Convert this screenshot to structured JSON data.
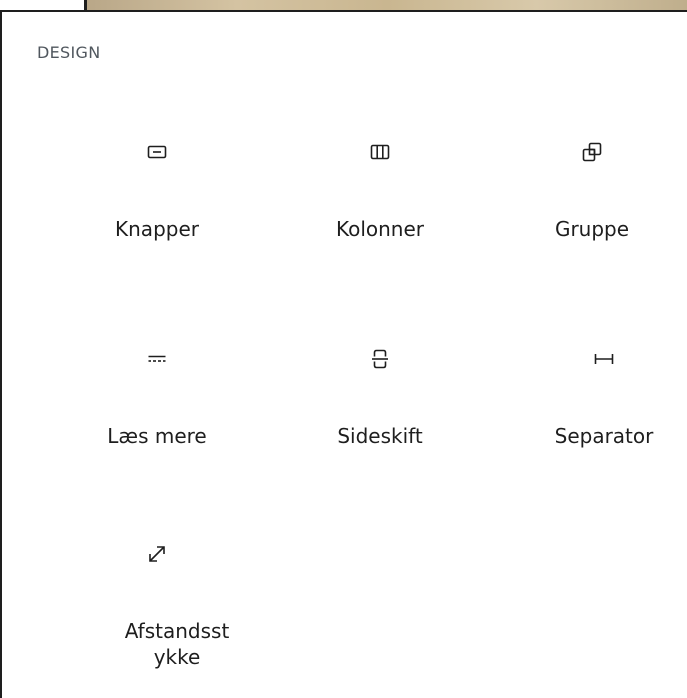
{
  "section": {
    "title": "DESIGN"
  },
  "blocks": [
    {
      "label": "Knapper",
      "icon": "buttons-icon"
    },
    {
      "label": "Kolonner",
      "icon": "columns-icon"
    },
    {
      "label": "Gruppe",
      "icon": "group-icon"
    },
    {
      "label": "Læs mere",
      "icon": "more-icon"
    },
    {
      "label": "Sideskift",
      "icon": "page-break-icon"
    },
    {
      "label": "Separator",
      "icon": "separator-icon"
    },
    {
      "label": "Afstandsstykke",
      "icon": "spacer-icon"
    }
  ]
}
